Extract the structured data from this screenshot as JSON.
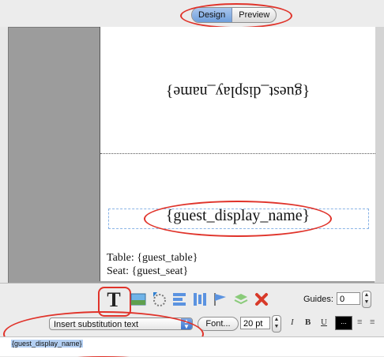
{
  "mode_tabs": {
    "design": "Design",
    "preview": "Preview",
    "active": "Design"
  },
  "card": {
    "flipped_text": "{guest_display_name}",
    "name_text": "{guest_display_name}",
    "table_line": "Table: {guest_table}",
    "seat_line": "Seat: {guest_seat}"
  },
  "toolbar": {
    "text_tool_glyph": "T",
    "guides_label": "Guides:",
    "guides_value": "0",
    "insert_select_value": "Insert substitution text",
    "font_button": "Font...",
    "font_size": "20 pt",
    "italic": "I",
    "bold": "B",
    "underline": "U",
    "color_swatch": "..."
  },
  "text_field": {
    "value": "{guest_display_name}"
  },
  "colors": {
    "highlight_oval": "#e0332a",
    "selection": "#b4d0f3",
    "guide_dash": "#8ab4e6"
  }
}
